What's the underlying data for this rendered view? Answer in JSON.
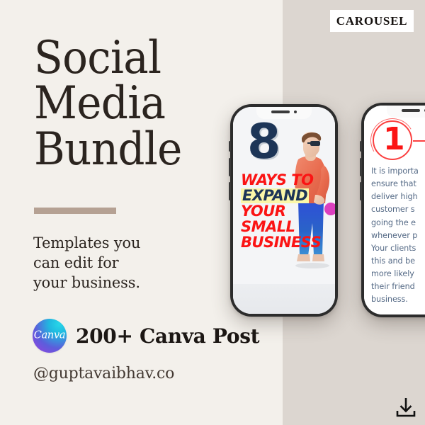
{
  "badge": {
    "label": "CAROUSEL"
  },
  "headline": {
    "line1": "Social",
    "line2": "Media",
    "line3": "Bundle"
  },
  "subcopy": {
    "line1": "Templates you",
    "line2": "can edit for",
    "line3": "your business."
  },
  "canva": {
    "logo_mark": "Canva",
    "logo_icon": "canva-logo-icon",
    "label": "200+ Canva Post"
  },
  "handle": {
    "text": "@guptavaibhav.co"
  },
  "download": {
    "icon": "download-icon"
  },
  "phone1": {
    "notch_speaker": "speaker-icon",
    "notch_camera": "camera-icon",
    "slide": {
      "number": "8",
      "line1": "WAYS TO",
      "line2": "EXPAND",
      "line3": "YOUR",
      "line4": "SMALL",
      "line5": "BUSINESS",
      "illustration": "man-standing-illustration"
    }
  },
  "phone2": {
    "slide": {
      "number": "1",
      "body_lines": [
        "It is importa",
        "ensure that",
        "deliver high",
        "customer s",
        "going the e",
        "whenever p",
        "Your clients",
        "this and be",
        "more likely",
        "their friend",
        "business."
      ]
    }
  },
  "colors": {
    "bg_left": "#f3f0eb",
    "bg_right": "#dcd6d0",
    "ink": "#2b241f",
    "rule": "#b5a193",
    "accent_red": "#fb1414",
    "accent_navy": "#1d3557",
    "highlight_yellow": "#fbf7a8",
    "body_blue": "#556a86"
  }
}
